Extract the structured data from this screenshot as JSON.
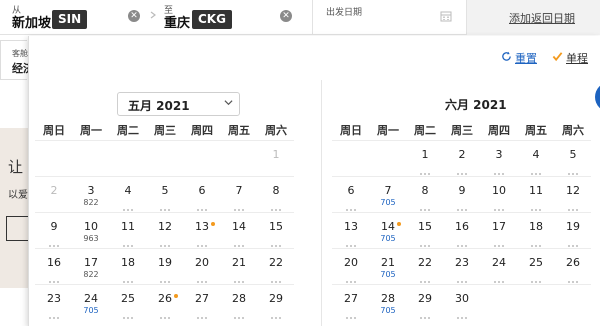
{
  "search": {
    "from_caption": "从",
    "from_city": "新加坡",
    "from_code": "SIN",
    "to_caption": "至",
    "to_city": "重庆",
    "to_code": "CKG",
    "clear_glyph": "✕",
    "date_caption": "出发日期",
    "return_label": "添加返回日期"
  },
  "cabin": {
    "caption": "客舱",
    "value": "经济"
  },
  "banner": {
    "title": "让",
    "subtitle": "以爱"
  },
  "toolbar": {
    "reset_label": "重置",
    "oneway_label": "单程"
  },
  "calendar": {
    "weekdays": [
      "周日",
      "周一",
      "周二",
      "周三",
      "周四",
      "周五",
      "周六"
    ],
    "left_month": "五月 2021",
    "right_month": "六月 2021",
    "may_days": [
      {
        "d": "1",
        "dis": true,
        "price": "",
        "promo": false
      },
      {
        "d": "2",
        "dis": true,
        "price": "",
        "promo": false
      },
      {
        "d": "3",
        "dis": false,
        "price": "822",
        "promo": false
      },
      {
        "d": "4",
        "dis": false,
        "price": "",
        "promo": false
      },
      {
        "d": "5",
        "dis": false,
        "price": "",
        "promo": false
      },
      {
        "d": "6",
        "dis": false,
        "price": "",
        "promo": false
      },
      {
        "d": "7",
        "dis": false,
        "price": "",
        "promo": false
      },
      {
        "d": "8",
        "dis": false,
        "price": "",
        "promo": false
      },
      {
        "d": "9",
        "dis": false,
        "price": "",
        "promo": false
      },
      {
        "d": "10",
        "dis": false,
        "price": "963",
        "promo": false
      },
      {
        "d": "11",
        "dis": false,
        "price": "",
        "promo": false
      },
      {
        "d": "12",
        "dis": false,
        "price": "",
        "promo": false
      },
      {
        "d": "13",
        "dis": false,
        "price": "",
        "promo": true
      },
      {
        "d": "14",
        "dis": false,
        "price": "",
        "promo": false
      },
      {
        "d": "15",
        "dis": false,
        "price": "",
        "promo": false
      },
      {
        "d": "16",
        "dis": false,
        "price": "",
        "promo": false
      },
      {
        "d": "17",
        "dis": false,
        "price": "822",
        "promo": false
      },
      {
        "d": "18",
        "dis": false,
        "price": "",
        "promo": false
      },
      {
        "d": "19",
        "dis": false,
        "price": "",
        "promo": false
      },
      {
        "d": "20",
        "dis": false,
        "price": "",
        "promo": false
      },
      {
        "d": "21",
        "dis": false,
        "price": "",
        "promo": false
      },
      {
        "d": "22",
        "dis": false,
        "price": "",
        "promo": false
      },
      {
        "d": "23",
        "dis": false,
        "price": "",
        "promo": false
      },
      {
        "d": "24",
        "dis": false,
        "price": "705",
        "blue": true,
        "promo": false
      },
      {
        "d": "25",
        "dis": false,
        "price": "",
        "promo": false
      },
      {
        "d": "26",
        "dis": false,
        "price": "",
        "promo": true
      },
      {
        "d": "27",
        "dis": false,
        "price": "",
        "promo": false
      },
      {
        "d": "28",
        "dis": false,
        "price": "",
        "promo": false
      },
      {
        "d": "29",
        "dis": false,
        "price": "",
        "promo": false
      }
    ],
    "june_days": [
      {
        "d": "1",
        "price": "",
        "promo": false
      },
      {
        "d": "2",
        "price": "",
        "promo": false
      },
      {
        "d": "3",
        "price": "",
        "promo": false
      },
      {
        "d": "4",
        "price": "",
        "promo": false
      },
      {
        "d": "5",
        "price": "",
        "promo": false
      },
      {
        "d": "6",
        "price": "",
        "promo": false
      },
      {
        "d": "7",
        "price": "705",
        "promo": false
      },
      {
        "d": "8",
        "price": "",
        "promo": false
      },
      {
        "d": "9",
        "price": "",
        "promo": false
      },
      {
        "d": "10",
        "price": "",
        "promo": false
      },
      {
        "d": "11",
        "price": "",
        "promo": false
      },
      {
        "d": "12",
        "price": "",
        "promo": false
      },
      {
        "d": "13",
        "price": "",
        "promo": false
      },
      {
        "d": "14",
        "price": "705",
        "promo": true
      },
      {
        "d": "15",
        "price": "",
        "promo": false
      },
      {
        "d": "16",
        "price": "",
        "promo": false
      },
      {
        "d": "17",
        "price": "",
        "promo": false
      },
      {
        "d": "18",
        "price": "",
        "promo": false
      },
      {
        "d": "19",
        "price": "",
        "promo": false
      },
      {
        "d": "20",
        "price": "",
        "promo": false
      },
      {
        "d": "21",
        "price": "705",
        "promo": false
      },
      {
        "d": "22",
        "price": "",
        "promo": false
      },
      {
        "d": "23",
        "price": "",
        "promo": false
      },
      {
        "d": "24",
        "price": "",
        "promo": false
      },
      {
        "d": "25",
        "price": "",
        "promo": false
      },
      {
        "d": "26",
        "price": "",
        "promo": false
      },
      {
        "d": "27",
        "price": "",
        "promo": false
      },
      {
        "d": "28",
        "price": "705",
        "promo": false
      },
      {
        "d": "29",
        "price": "",
        "promo": false
      },
      {
        "d": "30",
        "price": "",
        "promo": false
      }
    ],
    "accent_color": "#1d63c0",
    "promo_color": "#f39a1e"
  }
}
